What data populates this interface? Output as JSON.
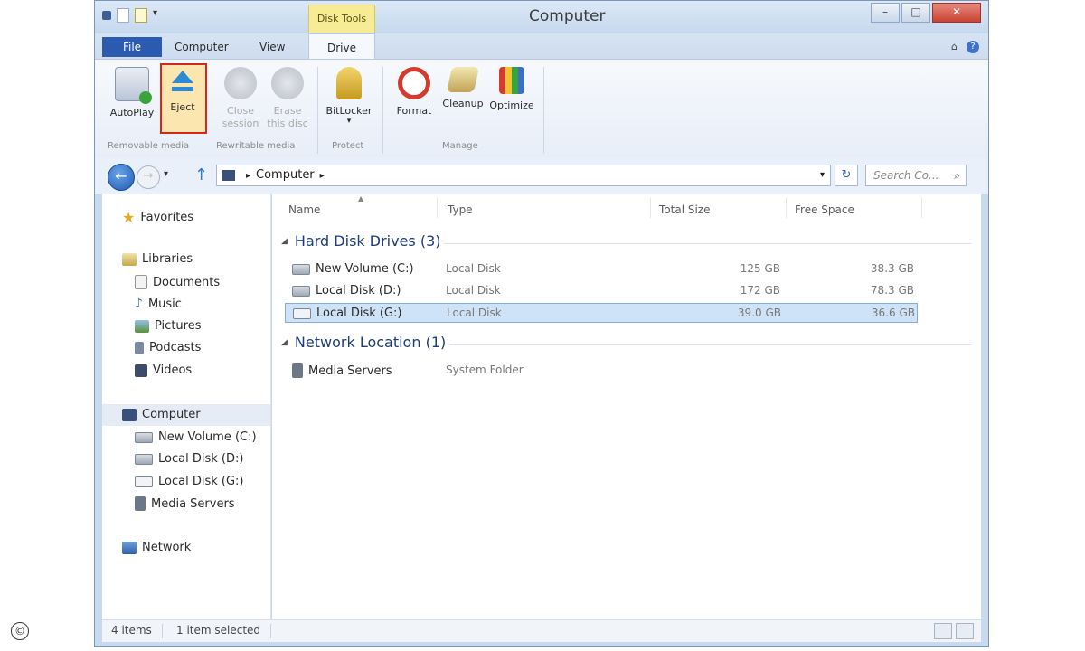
{
  "window": {
    "title": "Computer"
  },
  "contextual_tab": {
    "label": "Disk Tools"
  },
  "tabs": {
    "file": "File",
    "computer": "Computer",
    "view": "View",
    "drive": "Drive"
  },
  "ribbon": {
    "autoplay": "AutoPlay",
    "eject": "Eject",
    "close_session": [
      "Close",
      "session"
    ],
    "erase_disc": [
      "Erase",
      "this disc"
    ],
    "bitlocker": "BitLocker",
    "format": "Format",
    "cleanup": "Cleanup",
    "optimize": "Optimize",
    "groups": {
      "removable": "Removable media",
      "rewritable": "Rewritable media",
      "protect": "Protect",
      "manage": "Manage"
    }
  },
  "address": {
    "crumb": "Computer",
    "search_placeholder": "Search Co..."
  },
  "nav": {
    "favorites": "Favorites",
    "libraries": "Libraries",
    "documents": "Documents",
    "music": "Music",
    "pictures": "Pictures",
    "podcasts": "Podcasts",
    "videos": "Videos",
    "computer": "Computer",
    "new_volume_c": "New Volume (C:)",
    "local_disk_d": "Local Disk (D:)",
    "local_disk_g": "Local Disk (G:)",
    "media_servers": "Media Servers",
    "network": "Network"
  },
  "columns": {
    "name": "Name",
    "type": "Type",
    "total": "Total Size",
    "free": "Free Space"
  },
  "groups": {
    "hdd": "Hard Disk Drives (3)",
    "network": "Network Location (1)"
  },
  "drives": [
    {
      "name": "New Volume (C:)",
      "type": "Local Disk",
      "total": "125 GB",
      "free": "38.3 GB"
    },
    {
      "name": "Local Disk (D:)",
      "type": "Local Disk",
      "total": "172 GB",
      "free": "78.3 GB"
    },
    {
      "name": "Local Disk (G:)",
      "type": "Local Disk",
      "total": "39.0 GB",
      "free": "36.6 GB"
    }
  ],
  "network_items": [
    {
      "name": "Media Servers",
      "type": "System Folder"
    }
  ],
  "status": {
    "items": "4 items",
    "selected": "1 item selected"
  },
  "colors": {
    "accent": "#2b5bb0",
    "contextual": "#f7ec95",
    "highlight": "#d5291e",
    "selection": "#cfe3f8"
  },
  "copyright_symbol": "©"
}
